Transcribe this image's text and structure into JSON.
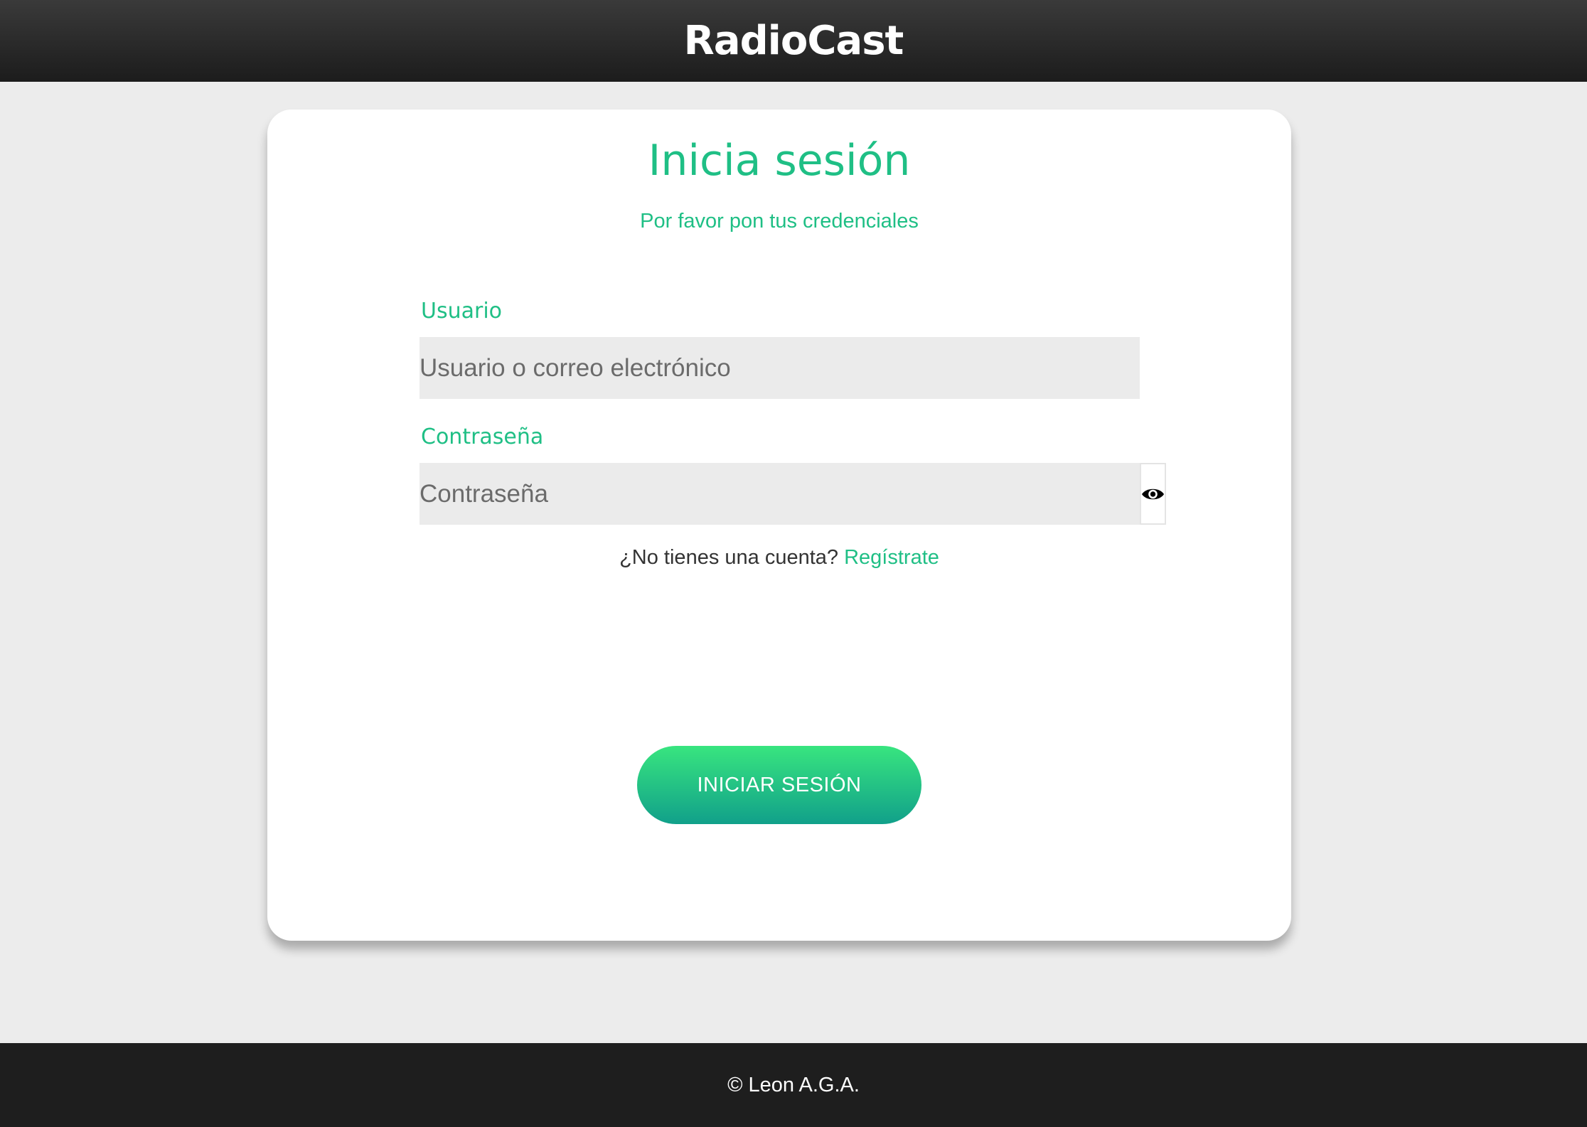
{
  "header": {
    "brand": "RadioCast"
  },
  "login": {
    "title": "Inicia sesión",
    "subtitle": "Por favor pon tus credenciales",
    "username_label": "Usuario",
    "username_placeholder": "Usuario o correo electrónico",
    "username_value": "",
    "password_label": "Contraseña",
    "password_placeholder": "Contraseña",
    "password_value": "",
    "password_toggle_icon": "eye-icon",
    "register_prompt": "¿No tienes una cuenta?",
    "register_link": "Regístrate",
    "submit_label": "INICIAR SESIÓN"
  },
  "footer": {
    "copyright": "© Leon A.G.A."
  },
  "colors": {
    "accent": "#1fbf85",
    "button_gradient_top": "#38e57f",
    "button_gradient_bottom": "#11a08a",
    "header_bg": "#2a2a2a",
    "footer_bg": "#1e1e1e",
    "page_bg": "#ececec"
  }
}
